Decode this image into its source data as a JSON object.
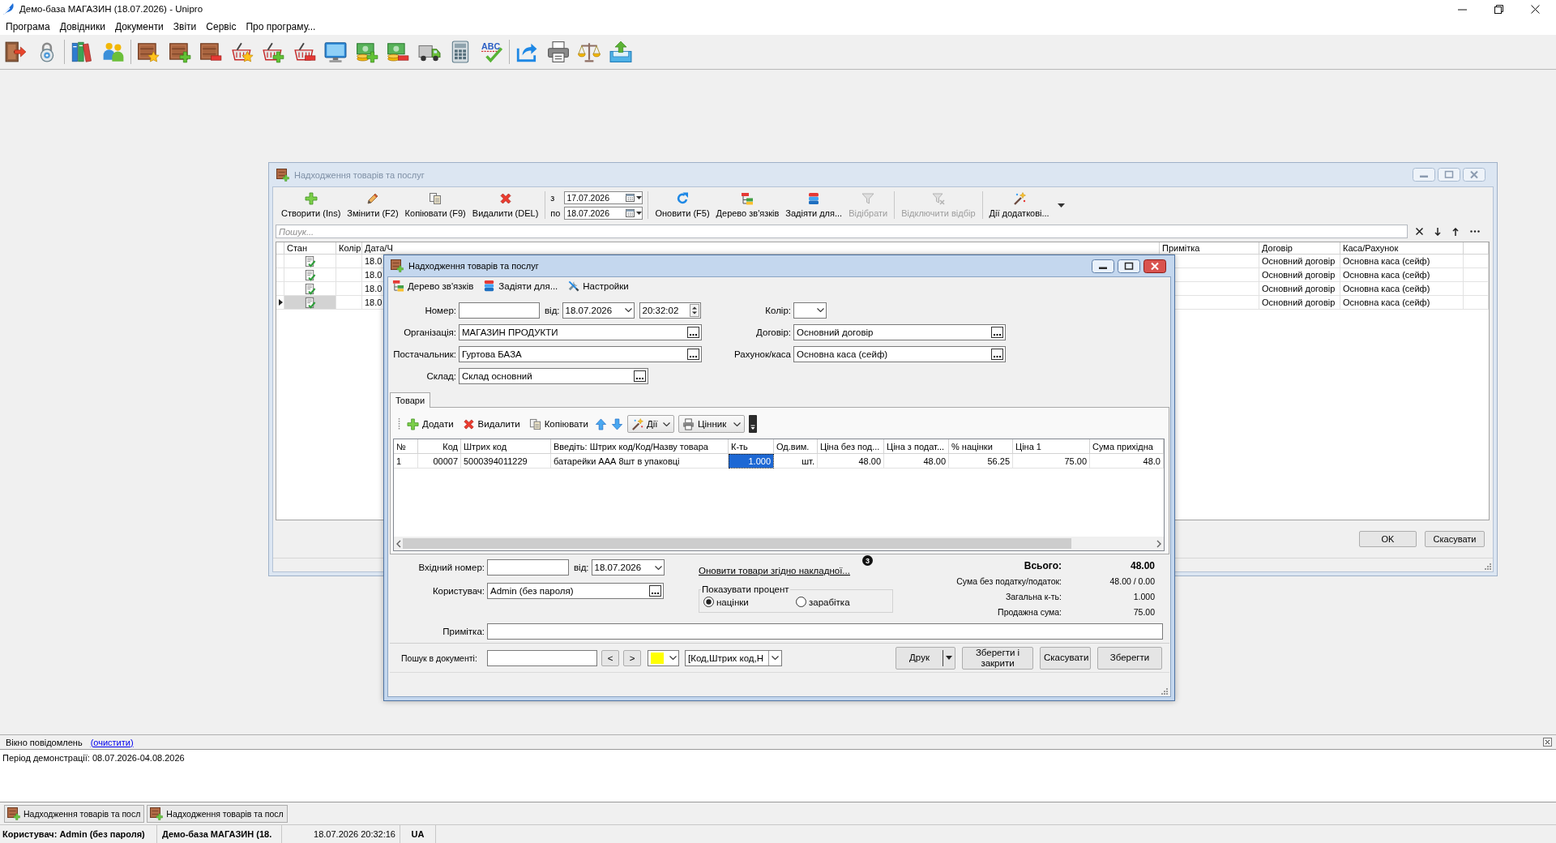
{
  "window": {
    "title": "Демо-база МАГАЗИН (18.07.2026) - Unipro"
  },
  "menu": [
    "Програма",
    "Довідники",
    "Документи",
    "Звіти",
    "Сервіс",
    "Про програму..."
  ],
  "toolbar": {
    "spellcheck_icon_text": "ABC"
  },
  "journal_window": {
    "title": "Надходження товарів та послуг",
    "active": false,
    "toolbar": [
      {
        "kind": "button",
        "label": "Створити (Ins)",
        "disabled": false
      },
      {
        "kind": "button",
        "label": "Змінити (F2)",
        "disabled": false
      },
      {
        "kind": "button",
        "label": "Копіювати (F9)",
        "disabled": false
      },
      {
        "kind": "button",
        "label": "Видалити (DEL)",
        "disabled": false
      },
      {
        "kind": "period",
        "from_label": "з",
        "from": "17.07.2026",
        "to_label": "по",
        "to": "18.07.2026"
      },
      {
        "kind": "button",
        "label": "Оновити (F5)",
        "disabled": false
      },
      {
        "kind": "button",
        "label": "Дерево зв'язків",
        "disabled": false
      },
      {
        "kind": "button",
        "label": "Задіяти для...",
        "disabled": false
      },
      {
        "kind": "button",
        "label": "Відібрати",
        "disabled": true
      },
      {
        "kind": "button",
        "label": "Відключити відбір",
        "disabled": true
      },
      {
        "kind": "button",
        "label": "Дії додаткові...",
        "disabled": false
      }
    ],
    "search": {
      "placeholder": "Пошук..."
    },
    "table": {
      "columns": [
        "Стан",
        "Колір",
        "Дата/Ч",
        "Примітка",
        "Договір",
        "Каса/Рахунок"
      ],
      "rows": [
        {
          "posted": true,
          "date": "18.0",
          "contract": "Основний договір",
          "cash_account": "Основна каса (сейф)",
          "selected": false
        },
        {
          "posted": true,
          "date": "18.0",
          "contract": "Основний договір",
          "cash_account": "Основна каса (сейф)",
          "selected": false
        },
        {
          "posted": true,
          "date": "18.0",
          "contract": "Основний договір",
          "cash_account": "Основна каса (сейф)",
          "selected": false
        },
        {
          "posted": true,
          "date": "18.0",
          "contract": "Основний договір",
          "cash_account": "Основна каса (сейф)",
          "selected": true
        }
      ]
    },
    "buttons": [
      "OK",
      "Скасувати"
    ]
  },
  "document_dialog": {
    "title": "Надходження товарів та послуг",
    "active": true,
    "toolbar": [
      "Дерево зв'язків",
      "Задіяти для...",
      "Настройки"
    ],
    "number": {
      "label": "Номер:"
    },
    "date": {
      "label": "від:",
      "value": "18.07.2026"
    },
    "time": {
      "value": "20:32:02"
    },
    "color": {
      "label": "Колір:"
    },
    "left_fields": [
      {
        "label": "Організація:",
        "value": "МАГАЗИН ПРОДУКТИ"
      },
      {
        "label": "Постачальник:",
        "value": "Гуртова БАЗА"
      },
      {
        "label": "Склад:",
        "value": "Склад основний"
      }
    ],
    "right_fields": [
      {
        "label": "Договір:",
        "value": "Основний договір"
      },
      {
        "label": "Рахунок/каса",
        "value": "Основна каса (сейф)"
      }
    ],
    "tabs": [
      {
        "label": "Товари",
        "selected": true
      }
    ],
    "goods_toolbar": [
      {
        "kind": "button",
        "label": "Додати"
      },
      {
        "kind": "button",
        "label": "Видалити"
      },
      {
        "kind": "button",
        "label": "Копіювати"
      },
      {
        "kind": "dropdown",
        "label": "Дії"
      },
      {
        "kind": "dropdown",
        "label": "Цінник"
      }
    ],
    "goods": {
      "columns": [
        "№",
        "Код",
        "Штрих код",
        "Введіть: Штрих код/Код/Назву товара",
        "К-ть",
        "Од.вим.",
        "Ціна без под...",
        "Ціна з подат...",
        "% націнки",
        "Ціна 1",
        "Сума прихідна"
      ],
      "rows": [
        {
          "cells": [
            {
              "text": "1",
              "selected": false
            },
            {
              "text": "00007",
              "selected": false
            },
            {
              "text": "5000394011229",
              "selected": false
            },
            {
              "text": "батарейки ААА 8шт в упаковці",
              "selected": false
            },
            {
              "text": "1.000",
              "selected": true
            },
            {
              "text": "шт.",
              "selected": false
            },
            {
              "text": "48.00",
              "selected": false
            },
            {
              "text": "48.00",
              "selected": false
            },
            {
              "text": "56.25",
              "selected": false
            },
            {
              "text": "75.00",
              "selected": false
            },
            {
              "text": "48.0",
              "selected": false
            }
          ]
        }
      ]
    },
    "incoming_number": {
      "label": "Вхідний номер:"
    },
    "incoming_date": {
      "label": "від:",
      "value": "18.07.2026"
    },
    "user": {
      "label": "Користувач:",
      "value": "Admin (без пароля)"
    },
    "update_link": {
      "label": "Оновити товари згідно накладної...",
      "badge": "3"
    },
    "percent": {
      "title": "Показувати процент",
      "options": [
        {
          "label": "націнки",
          "selected": true
        },
        {
          "label": "зарабітка",
          "selected": false
        }
      ]
    },
    "totals": [
      {
        "kind": "grand",
        "label": "Всього:",
        "value": "48.00"
      },
      {
        "kind": "line",
        "label": "Сума без податку/податок:",
        "value": "48.00 / 0.00"
      },
      {
        "kind": "line",
        "label": "Загальна к-ть:",
        "value": "1.000"
      },
      {
        "kind": "line",
        "label": "Продажна сума:",
        "value": "75.00"
      }
    ],
    "note": {
      "label": "Примітка:"
    },
    "search": {
      "label": "Пошук в документі:",
      "prev": "<",
      "next": ">",
      "color": "#ffff00",
      "columns": "[Код,Штрих код,Н"
    },
    "buttons": [
      {
        "kind": "split",
        "label": "Друк"
      },
      {
        "kind": "plain",
        "label": "Зберегти і закрити"
      },
      {
        "kind": "plain",
        "label": "Скасувати"
      },
      {
        "kind": "plain",
        "label": "Зберегти"
      }
    ]
  },
  "messages": {
    "title": "Вікно повідомлень",
    "clear_link": "(очистити)",
    "lines": [
      "Період демонстрації: 08.07.2026-04.08.2026"
    ]
  },
  "open_windows": [
    "Надходження товарів та посл",
    "Надходження товарів та посл"
  ],
  "status_bar": {
    "user": "Користувач: Admin (без пароля)",
    "database": "Демо-база МАГАЗИН (18.",
    "datetime": "18.07.2026 20:32:16",
    "language": "UA"
  }
}
